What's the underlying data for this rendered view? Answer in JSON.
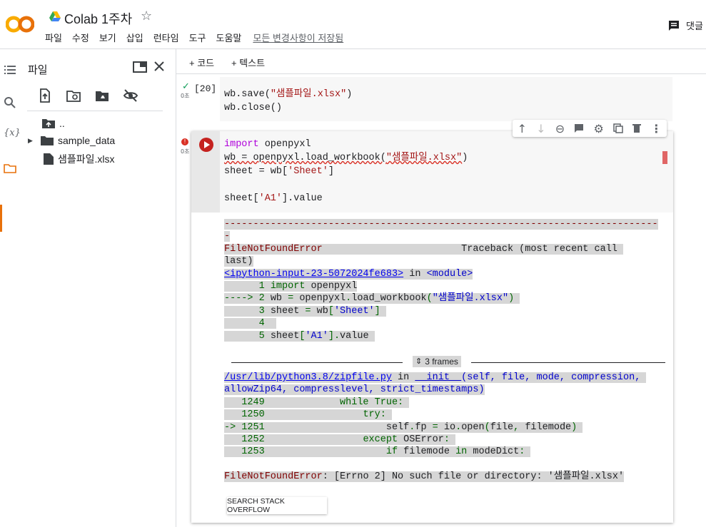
{
  "header": {
    "title": "Colab 1주차",
    "menu": [
      "파일",
      "수정",
      "보기",
      "삽입",
      "런타임",
      "도구",
      "도움말"
    ],
    "saved_status": "모든 변경사항이 저장됨",
    "comment_label": "댓글"
  },
  "files": {
    "title": "파일",
    "items": [
      "..",
      "sample_data",
      "샘플파일.xlsx"
    ]
  },
  "toolbar": {
    "add_code": "+ 코드",
    "add_text": "+ 텍스트"
  },
  "cell1": {
    "exec_count": "[20]",
    "time": "0초",
    "line1_a": "wb.save(",
    "line1_b": "\"샘플파일.xlsx\"",
    "line1_c": ")",
    "line2": "wb.close()"
  },
  "cell2": {
    "time": "0초",
    "l1_kw": "import",
    "l1_rest": " openpyxl",
    "l2_a": "wb = openpyxl.load_workbook(",
    "l2_b": "\"샘플파일.xlsx\"",
    "l2_c": ")",
    "l3_a": "sheet = wb[",
    "l3_b": "'Sheet'",
    "l3_c": "]",
    "l5_a": "sheet[",
    "l5_b": "'A1'",
    "l5_c": "].value"
  },
  "error": {
    "dashes": "---------------------------------------------------------------------------",
    "dash_tail": "-",
    "name": "FileNotFoundError",
    "traceback": "Traceback (most recent call ",
    "traceback2": "last)",
    "ipy_link": "<ipython-input-23-5072024fe683>",
    "in_text": " in ",
    "module": "<module>",
    "frames": "3 frames",
    "zip_link": "/usr/lib/python3.8/zipfile.py",
    "init_fn": "__init__",
    "init_args": "(self, file, mode, compression, ",
    "init_args2": "allowZip64, compresslevel, strict_timestamps)",
    "final_msg": ": [Errno 2] No such file or directory: '샘플파일.xlsx'",
    "so_button": "SEARCH STACK OVERFLOW"
  }
}
